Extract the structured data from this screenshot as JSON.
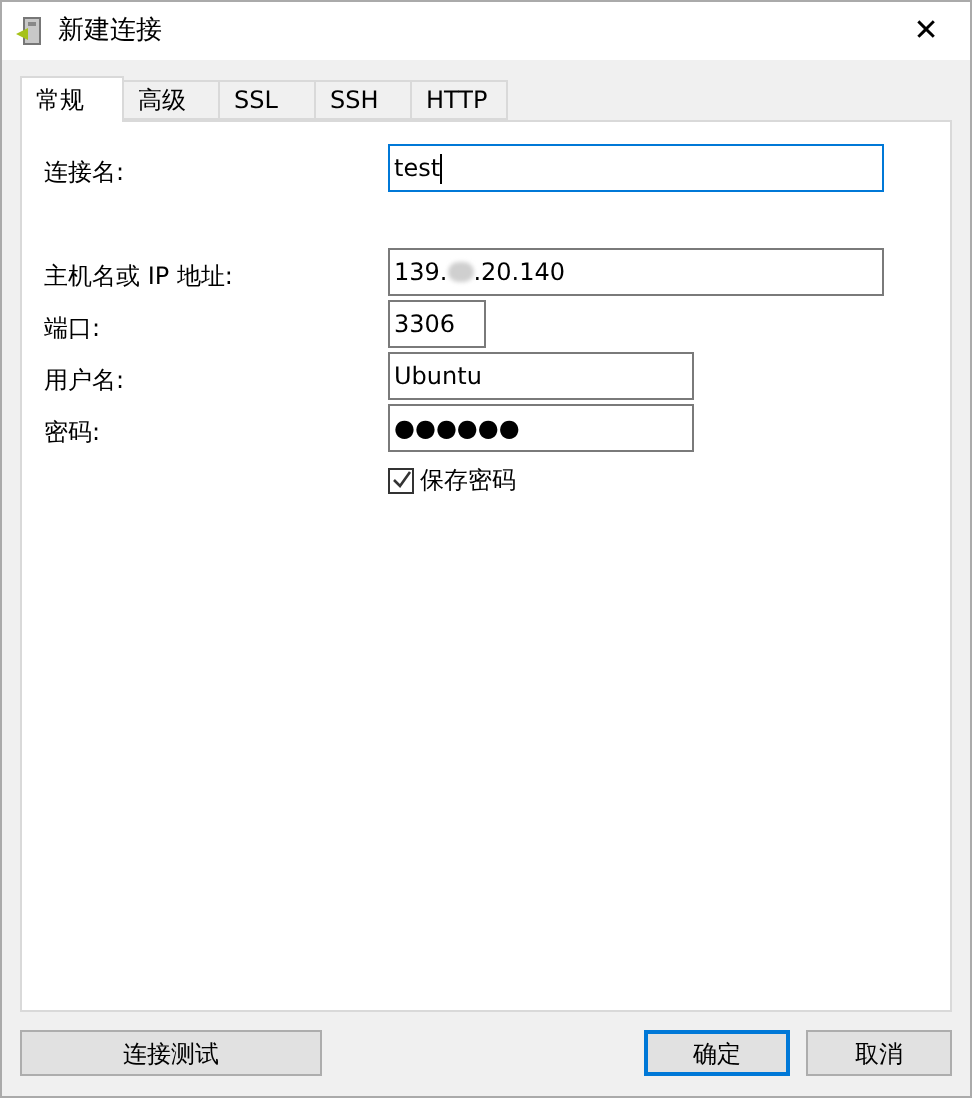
{
  "window": {
    "title": "新建连接",
    "close": "✕"
  },
  "tabs": [
    {
      "label": "常规",
      "selected": true
    },
    {
      "label": "高级",
      "selected": false
    },
    {
      "label": "SSL",
      "selected": false
    },
    {
      "label": "SSH",
      "selected": false
    },
    {
      "label": "HTTP",
      "selected": false
    }
  ],
  "form": {
    "connection_name": {
      "label": "连接名:",
      "value": "test",
      "focused": true
    },
    "host": {
      "label": "主机名或 IP 地址:",
      "value_start": "139.",
      "value_end": ".20.140"
    },
    "port": {
      "label": "端口:",
      "value": "3306"
    },
    "user": {
      "label": "用户名:",
      "value": "Ubuntu"
    },
    "password": {
      "label": "密码:",
      "value": "●●●●●●"
    },
    "save_password": {
      "label": "保存密码",
      "checked": true
    }
  },
  "buttons": [
    {
      "label": "连接测试",
      "default": false
    },
    {
      "label": "确定",
      "default": true
    },
    {
      "label": "取消",
      "default": false
    }
  ]
}
